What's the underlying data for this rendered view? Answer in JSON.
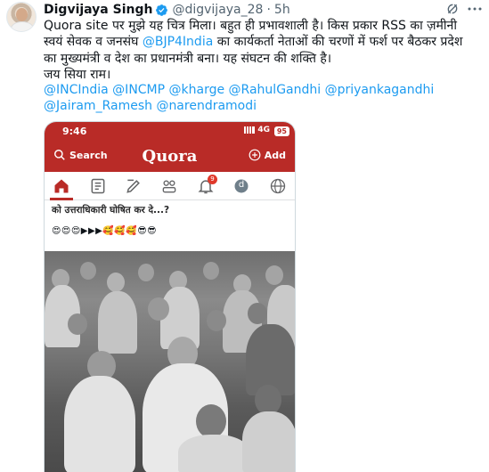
{
  "tweet": {
    "author_name": "Digvijaya Singh",
    "author_handle": "@digvijaya_28",
    "separator": "·",
    "time": "5h",
    "text_lines": [
      {
        "before": "Quora site पर मुझे यह चित्र मिला। बहुत ही प्रभावशाली है। किस प्रकार RSS का ज़मीनी",
        "mention": "",
        "after": ""
      },
      {
        "before": "स्वयं सेवक व जनसंघ ",
        "mention": "@BJP4India",
        "after": " का कार्यकर्ता नेताओं की चरणों में फर्श पर बैठकर प्रदेश"
      },
      {
        "before": "का मुख्यमंत्री व देश का प्रधानमंत्री बना। यह संघटन की शक्ति है।",
        "mention": "",
        "after": ""
      },
      {
        "before": "जय सिया राम।",
        "mention": "",
        "after": ""
      }
    ],
    "tags_line1": "@INCIndia @INCMP @kharge @RahulGandhi @priyankagandhi",
    "tags_line2": "@Jairam_Ramesh @narendramodi",
    "icons": {
      "verified": "verified-badge-icon",
      "grok": "grok-icon",
      "more": "more-icon"
    },
    "colors": {
      "link": "#1d9bf0",
      "text": "#0f1419",
      "muted": "#536471"
    }
  },
  "media": {
    "status_time": "9:46",
    "network": "4G",
    "battery": "95",
    "app_logo": "Quora",
    "search_label": "Search",
    "add_label": "Add",
    "notification_count": "9",
    "profile_initial": "d",
    "question_text": "को उत्तराधिकारी घोषित कर दे...?",
    "emoji_line": "😍😍😍▶▶▶🥰🥰🥰😎😎",
    "nav_icons": [
      "home-icon",
      "feed-icon",
      "write-icon",
      "spaces-icon",
      "bell-icon",
      "profile-icon",
      "globe-icon"
    ],
    "colors": {
      "quora_red": "#b92b27"
    }
  }
}
